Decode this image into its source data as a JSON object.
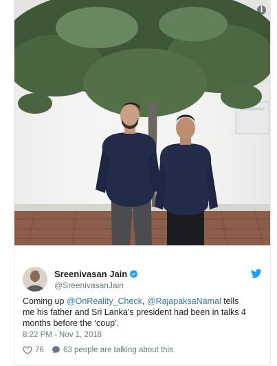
{
  "media": {
    "info_glyph": "i",
    "info_icon": "info-icon",
    "description_hidden": true
  },
  "author": {
    "name": "Sreenivasan Jain",
    "handle": "@SreenivasanJain",
    "verified_icon": "verified-badge-icon",
    "platform_icon": "twitter-bird-icon"
  },
  "tweet": {
    "text_prefix": "Coming up ",
    "mention_1": "@OnReality_Check",
    "text_middle": ", ",
    "mention_2": "@RajapaksaNamal",
    "text_suffix": " tells me his father and Sri Lanka’s president had been in talks 4 months before the ‘coup’.",
    "timestamp": "8:22 PM - Nov 1, 2018"
  },
  "actions": {
    "like_count": "76",
    "like_icon": "heart-icon",
    "talking_icon": "comment-icon",
    "talking_label": "63 people are talking about this"
  },
  "colors": {
    "link": "#2b7bb9",
    "secondary_text": "#697882",
    "verified": "#1da1f2",
    "twitter_blue": "#1da1f2"
  }
}
